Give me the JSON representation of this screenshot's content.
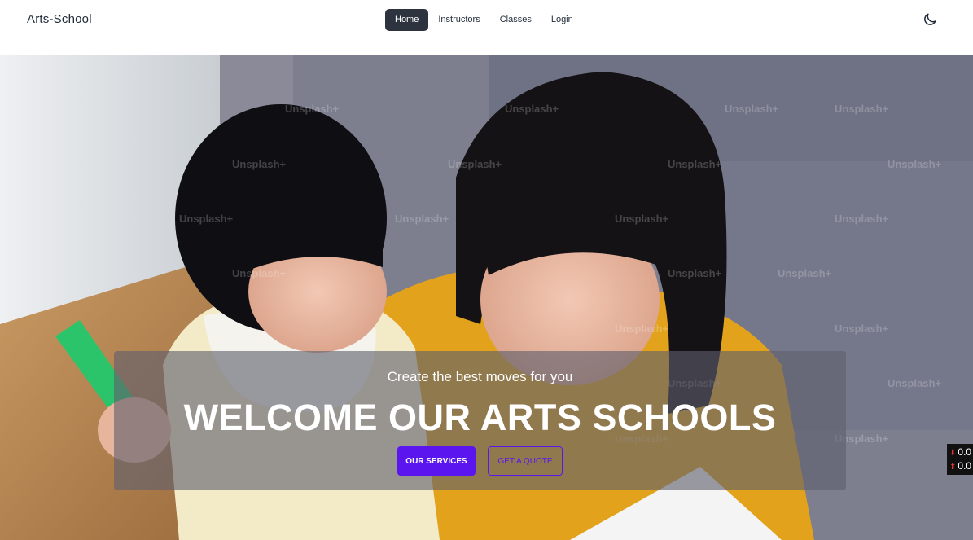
{
  "navbar": {
    "brand": "Arts-School",
    "items": [
      {
        "label": "Home",
        "active": true
      },
      {
        "label": "Instructors",
        "active": false
      },
      {
        "label": "Classes",
        "active": false
      },
      {
        "label": "Login",
        "active": false
      }
    ],
    "theme_icon": "moon-icon"
  },
  "hero": {
    "image_icon": "hero-photo",
    "watermark": "Unsplash+",
    "subtitle": "Create the best moves for you",
    "headline": "WELCOME OUR ARTS SCHOOLS",
    "primary_button": "OUR SERVICES",
    "secondary_button": "GET A QUOTE"
  },
  "speed_widget": {
    "download": "0.0",
    "upload": "0.0"
  },
  "colors": {
    "accent": "#5b16f0",
    "nav_active": "#2d3440"
  }
}
